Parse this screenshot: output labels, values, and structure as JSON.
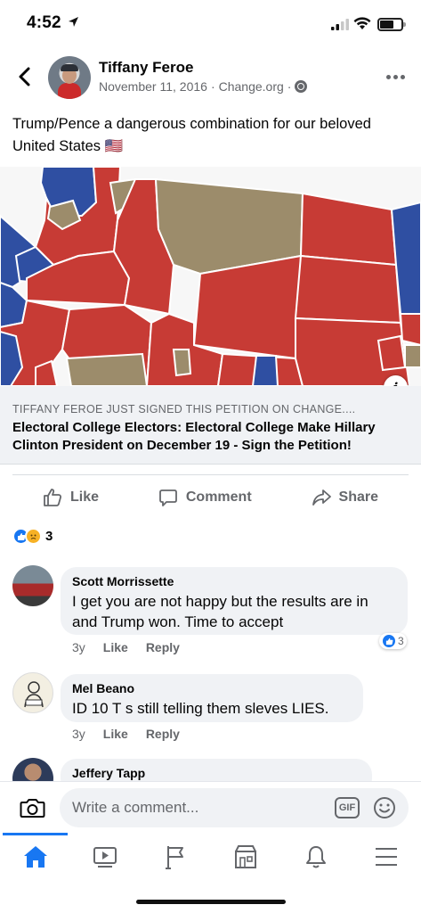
{
  "status_bar": {
    "time": "4:52"
  },
  "post": {
    "author": "Tiffany Feroe",
    "date": "November 11, 2016",
    "separator": "·",
    "source": "Change.org",
    "text": "Trump/Pence a dangerous combination for our beloved United States 🇺🇸"
  },
  "link_preview": {
    "domain": "TIFFANY FEROE JUST SIGNED THIS PETITION ON CHANGE....",
    "title": "Electoral College Electors: Electoral College Make Hillary Clinton President on December 19 - Sign the Petition!",
    "info_label": "i"
  },
  "actions": {
    "like": "Like",
    "comment": "Comment",
    "share": "Share"
  },
  "reactions": {
    "count": "3"
  },
  "comments": [
    {
      "name": "Scott Morrissette",
      "text": "I get you are not happy but the results are in and Trump won. Time to accept",
      "age": "3y",
      "like": "Like",
      "reply": "Reply",
      "reaction_count": "3"
    },
    {
      "name": "Mel Beano",
      "text": "ID 10 T s  still telling them sleves LIES.",
      "age": "3y",
      "like": "Like",
      "reply": "Reply"
    },
    {
      "name": "Jeffery Tapp"
    }
  ],
  "composer": {
    "placeholder": "Write a comment...",
    "gif_label": "GIF"
  },
  "colors": {
    "accent": "#1877f2",
    "republican": "#c73b35",
    "democrat": "#2f4fa2",
    "neutral": "#9c8c6b"
  }
}
